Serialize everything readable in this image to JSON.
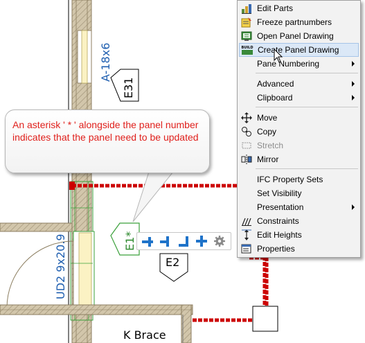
{
  "drawing": {
    "wall_label": "A-18x6",
    "top_tag": "E31",
    "panel_tag": "E1*",
    "panel_tag_below": "E2",
    "door_label": "UD2 9x20.9",
    "bottom_label": "K Brace"
  },
  "callout": {
    "text": "An asterisk ' * ' alongside the panel number indicates that the panel need to be updated"
  },
  "mini_toolbar": {
    "buttons": [
      "attach-left-icon",
      "attach-center-icon",
      "attach-corner-icon",
      "attach-cross-icon",
      "gear-icon"
    ]
  },
  "context_menu": {
    "items": [
      {
        "label": "Edit Parts",
        "icon": "edit-parts-icon"
      },
      {
        "label": "Freeze partnumbers",
        "icon": "freeze-icon"
      },
      {
        "label": "Open Panel Drawing",
        "icon": "open-drawing-icon"
      },
      {
        "label": "Create Panel Drawing",
        "icon": "build-icon",
        "icon_text": "BUILD"
      },
      {
        "label": "Pane Numbering",
        "icon": "",
        "submenu": true
      },
      {
        "label": "Advanced",
        "submenu": true
      },
      {
        "label": "Clipboard",
        "submenu": true
      },
      {
        "label": "Move",
        "icon": "move-icon"
      },
      {
        "label": "Copy",
        "icon": "copy-icon"
      },
      {
        "label": "Stretch",
        "icon": "stretch-icon",
        "disabled": true
      },
      {
        "label": "Mirror",
        "icon": "mirror-icon"
      },
      {
        "label": "IFC Property Sets"
      },
      {
        "label": "Set Visibility"
      },
      {
        "label": "Presentation",
        "submenu": true
      },
      {
        "label": "Constraints",
        "icon": "constraints-icon"
      },
      {
        "label": "Edit Heights",
        "icon": "edit-heights-icon"
      },
      {
        "label": "Properties",
        "icon": "properties-icon"
      }
    ]
  },
  "colors": {
    "wall": "#b8a98a",
    "highlight_red": "#cc0000",
    "callout_text": "#e0201c",
    "label_blue": "#1f5fb0",
    "panel_green": "#3aa03a",
    "tool_blue": "#1f73c9"
  }
}
